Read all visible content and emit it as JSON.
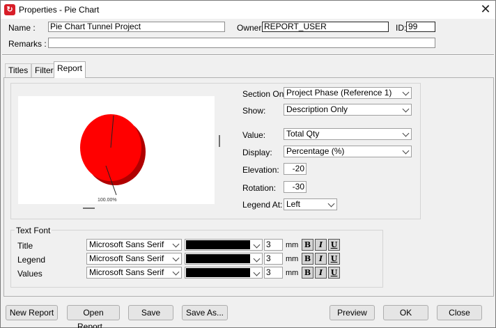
{
  "window": {
    "title": "Properties - Pie Chart",
    "app_icon_glyph": "↻"
  },
  "header": {
    "name_label": "Name :",
    "name_value": "Pie Chart Tunnel Project",
    "owner_label": "Owner:",
    "owner_value": "REPORT_USER",
    "id_label": "ID:",
    "id_value": "99",
    "remarks_label": "Remarks :",
    "remarks_value": ""
  },
  "tabs": [
    {
      "label": "Titles",
      "active": false
    },
    {
      "label": "Filter",
      "active": false
    },
    {
      "label": "Report",
      "active": true
    }
  ],
  "report": {
    "section_on_label": "Section On:",
    "section_on_value": "Project Phase (Reference 1)",
    "show_label": "Show:",
    "show_value": "Description Only",
    "value_label": "Value:",
    "value_value": "Total Qty",
    "display_label": "Display:",
    "display_value": "Percentage (%)",
    "elevation_label": "Elevation:",
    "elevation_value": "-20",
    "rotation_label": "Rotation:",
    "rotation_value": "-30",
    "legend_at_label": "Legend At:",
    "legend_at_value": "Left"
  },
  "preview": {
    "slice_label": "100.00%",
    "slice_color": "#ff0000",
    "slice_side_color": "#b00000"
  },
  "text_font": {
    "group_label": "Text Font",
    "unit": "mm",
    "rows": [
      {
        "label": "Title",
        "font": "Microsoft Sans Serif",
        "size": "3"
      },
      {
        "label": "Legend",
        "font": "Microsoft Sans Serif",
        "size": "3"
      },
      {
        "label": "Values",
        "font": "Microsoft Sans Serif",
        "size": "3"
      }
    ],
    "bold": "B",
    "italic": "I",
    "underline": "U"
  },
  "buttons": {
    "new_report": "New Report",
    "open_report": "Open Report...",
    "save": "Save",
    "save_as": "Save As...",
    "preview": "Preview",
    "ok": "OK",
    "close": "Close"
  }
}
